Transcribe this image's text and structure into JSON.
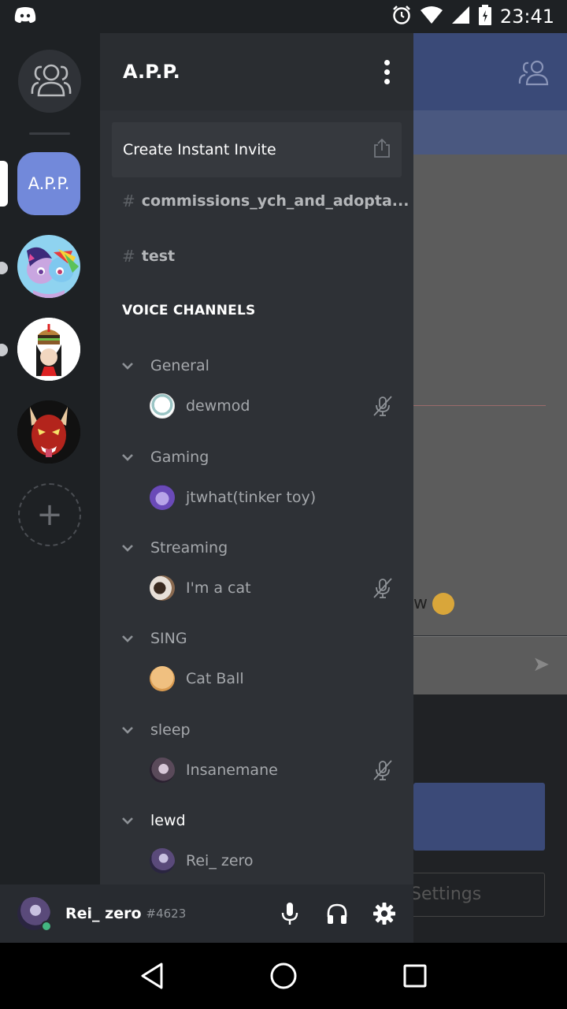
{
  "status_bar": {
    "time": "23:41"
  },
  "server": {
    "name": "A.P.P."
  },
  "guilds": [
    {
      "label": "A.P.P."
    }
  ],
  "invite": {
    "label": "Create Instant Invite"
  },
  "text_channels": [
    {
      "name": "commissions_ych_and_adopta..."
    },
    {
      "name": "test"
    }
  ],
  "voice_section_title": "VOICE CHANNELS",
  "voice_channels": [
    {
      "name": "General",
      "users": [
        {
          "name": "dewmod",
          "muted": true
        }
      ]
    },
    {
      "name": "Gaming",
      "users": [
        {
          "name": "jtwhat(tinker toy)",
          "muted": false
        }
      ]
    },
    {
      "name": "Streaming",
      "users": [
        {
          "name": "I'm a cat",
          "muted": true
        }
      ]
    },
    {
      "name": "SING",
      "users": [
        {
          "name": "Cat Ball",
          "muted": false
        }
      ]
    },
    {
      "name": "sleep",
      "users": [
        {
          "name": "Insanemane",
          "muted": true
        }
      ]
    },
    {
      "name": "lewd",
      "users": [
        {
          "name": "Rei_ zero",
          "muted": false
        }
      ]
    }
  ],
  "user_panel": {
    "name": "Rei_ zero",
    "tag": "#4623"
  },
  "background": {
    "settings_label": "Settings",
    "message_fragment": "w"
  },
  "colors": {
    "accent": "#7289da",
    "online": "#43b581",
    "drawer": "#2e3136",
    "sidebar": "#1e2124"
  }
}
